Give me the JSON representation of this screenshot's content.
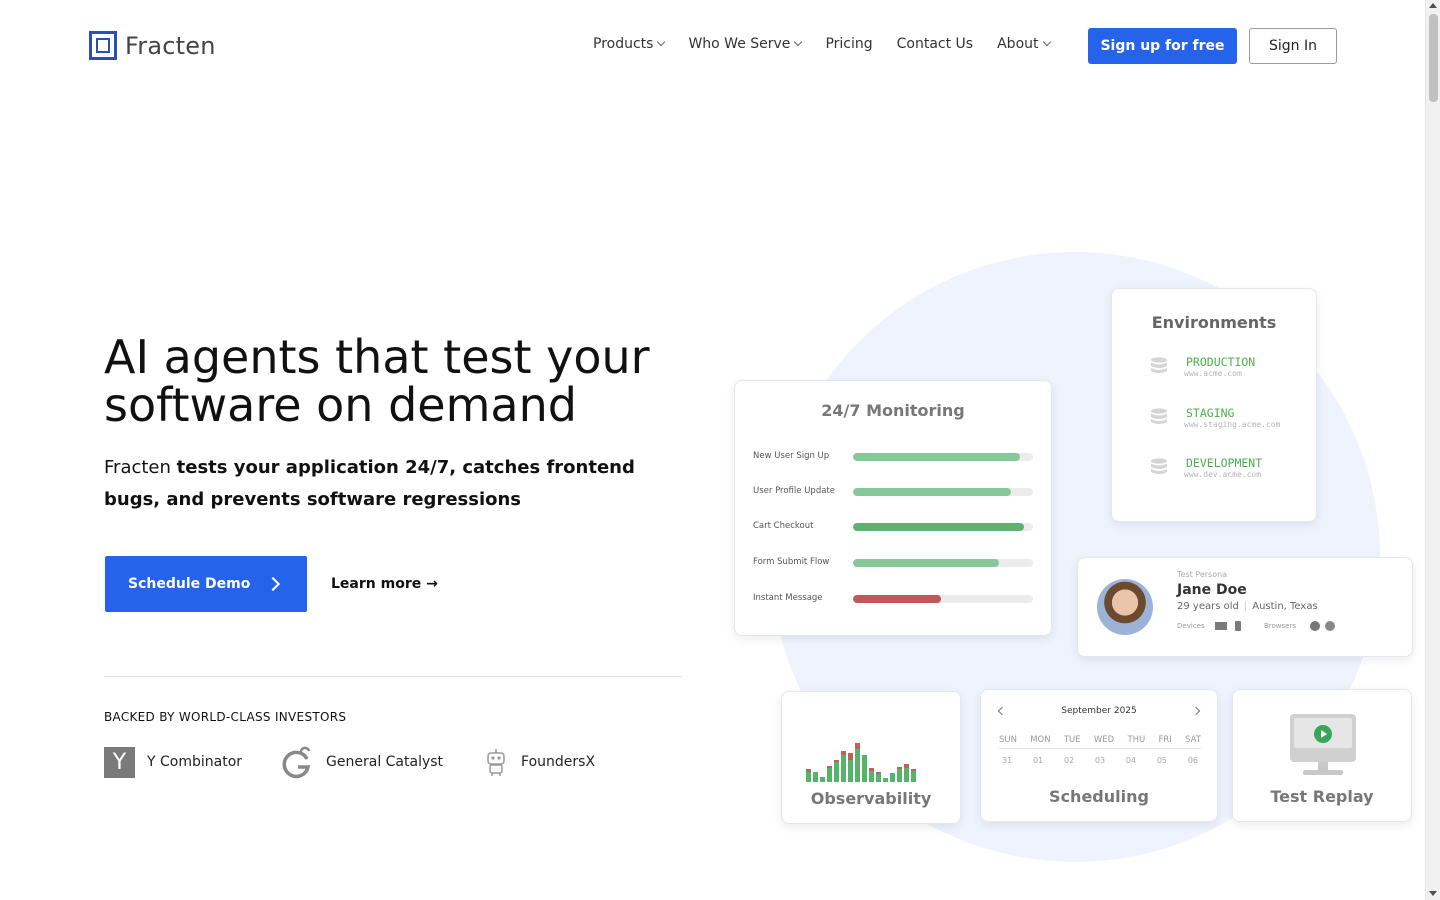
{
  "header": {
    "logo_text": "Fracten",
    "nav": [
      {
        "label": "Products",
        "dropdown": true
      },
      {
        "label": "Who We Serve",
        "dropdown": true
      },
      {
        "label": "Pricing",
        "dropdown": false
      },
      {
        "label": "Contact Us",
        "dropdown": false
      },
      {
        "label": "About",
        "dropdown": true
      }
    ],
    "signup_label": "Sign up for free",
    "signin_label": "Sign In"
  },
  "hero": {
    "title": "AI agents that test your software on demand",
    "subtitle_prefix": "Fracten ",
    "subtitle_bold": "tests your application 24/7, catches frontend bugs, and prevents software regressions",
    "demo_label": "Schedule Demo",
    "learn_more": "Learn more →"
  },
  "investors": {
    "title": "BACKED BY WORLD-CLASS INVESTORS",
    "items": [
      {
        "name": "Y Combinator",
        "icon": "y-combinator-logo"
      },
      {
        "name": "General Catalyst",
        "icon": "general-catalyst-logo"
      },
      {
        "name": "FoundersX",
        "icon": "robot-logo"
      }
    ]
  },
  "monitoring": {
    "title": "24/7 Monitoring",
    "rows": [
      {
        "label": "New User Sign Up",
        "progress": 0.93,
        "color": "#86c89a"
      },
      {
        "label": "User Profile Update",
        "progress": 0.88,
        "color": "#86c89a"
      },
      {
        "label": "Cart Checkout",
        "progress": 0.95,
        "color": "#5bb36f"
      },
      {
        "label": "Form Submit Flow",
        "progress": 0.81,
        "color": "#86c89a"
      },
      {
        "label": "Instant Message",
        "progress": 0.49,
        "color": "#c0585a"
      }
    ]
  },
  "environments": {
    "title": "Environments",
    "items": [
      {
        "name": "PRODUCTION",
        "url": "www.acme.com"
      },
      {
        "name": "STAGING",
        "url": "www.staging.acme.com"
      },
      {
        "name": "DEVELOPMENT",
        "url": "www.dev.acme.com"
      }
    ]
  },
  "persona": {
    "label": "Test Persona",
    "name": "Jane Doe",
    "age": "29 years old",
    "location": "Austin, Texas",
    "devices_label": "Devices",
    "browsers_label": "Browsers"
  },
  "observability": {
    "title": "Observability",
    "bars": [
      {
        "green": 0.32,
        "red": 0.08
      },
      {
        "green": 0.24,
        "red": 0
      },
      {
        "green": 0.12,
        "red": 0
      },
      {
        "green": 0.4,
        "red": 0.05
      },
      {
        "green": 0.55,
        "red": 0.06
      },
      {
        "green": 0.78,
        "red": 0.1
      },
      {
        "green": 0.72,
        "red": 0.18
      },
      {
        "green": 0.98,
        "red": 0.15
      },
      {
        "green": 0.68,
        "red": 0
      },
      {
        "green": 0.35,
        "red": 0.07
      },
      {
        "green": 0.24,
        "red": 0.05
      },
      {
        "green": 0.1,
        "red": 0
      },
      {
        "green": 0.22,
        "red": 0
      },
      {
        "green": 0.38,
        "red": 0.05
      },
      {
        "green": 0.45,
        "red": 0.1
      },
      {
        "green": 0.32,
        "red": 0.06
      }
    ]
  },
  "scheduling": {
    "title": "Scheduling",
    "month": "September 2025",
    "days": [
      "SUN",
      "MON",
      "TUE",
      "WED",
      "THU",
      "FRI",
      "SAT"
    ],
    "dates": [
      "31",
      "01",
      "02",
      "03",
      "04",
      "05",
      "06"
    ]
  },
  "replay": {
    "title": "Test Replay"
  }
}
